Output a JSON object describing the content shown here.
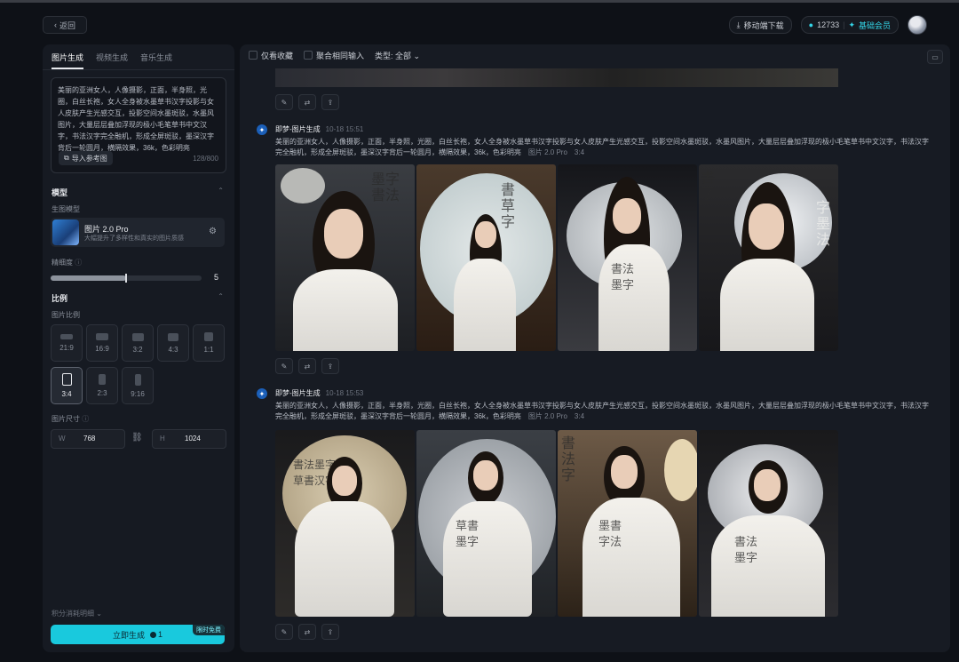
{
  "header": {
    "back_label": "返回",
    "mobile_download": "移动端下载",
    "credits": "12733",
    "membership": "基础会员"
  },
  "left": {
    "tabs": [
      "图片生成",
      "视频生成",
      "音乐生成"
    ],
    "prompt": "美丽的亚洲女人，人像摄影，正面，半身照，光圈，白丝长袍，女人全身被水墨草书汉字投影与女人皮肤产生光感交互，投影空间水墨斑驳，水墨风图片，大量层层叠加浮现的极小毛笔草书中文汉字，书法汉字完全融机，形成全屏斑驳，墨深汉字背后一轮圆月，横隔效果，36k，色彩明亮",
    "ref_button": "导入参考图",
    "counter": "128/800",
    "model_section": "模型",
    "model_label": "生图模型",
    "model_name": "图片 2.0 Pro",
    "model_desc": "大幅提升了多样性和真实的图片质感",
    "precision_label": "精细度",
    "precision_value": "5",
    "precision_fraction": 0.5,
    "ratio_section": "比例",
    "ratio_label": "图片比例",
    "ratios": [
      "21:9",
      "16:9",
      "3:2",
      "4:3",
      "1:1",
      "3:4",
      "2:3",
      "9:16"
    ],
    "selected_ratio": "3:4",
    "size_label": "图片尺寸",
    "width_label": "W",
    "width_value": "768",
    "height_label": "H",
    "height_value": "1024",
    "detail_label": "积分消耗明细",
    "generate_label": "立即生成",
    "generate_cost": "1",
    "limited_badge": "限时免费"
  },
  "right": {
    "filter_favorites": "仅看收藏",
    "filter_merge": "聚合相同输入",
    "filter_type": "类型: 全部",
    "jobs": [
      {
        "title": "即梦-图片生成",
        "time": "10-18  15:51",
        "prompt": "美丽的亚洲女人，人像摄影，正面，半身照，光圈，白丝长袍，女人全身被水墨草书汉字投影与女人皮肤产生光感交互，投影空间水墨斑驳，水墨风图片，大量层层叠加浮现的极小毛笔草书中文汉字，书法汉字完全融机，形成全屏斑驳，墨深汉字背后一轮圆月，横隔效果，36k，色彩明亮",
        "model": "图片 2.0 Pro",
        "ratio": "3:4"
      },
      {
        "title": "即梦-图片生成",
        "time": "10-18  15:53",
        "prompt": "美丽的亚洲女人，人像摄影，正面，半身照，光圈，白丝长袍，女人全身被水墨草书汉字投影与女人皮肤产生光感交互，投影空间水墨斑驳，水墨风图片，大量层层叠加浮现的极小毛笔草书中文汉字，书法汉字完全融机，形成全屏斑驳，墨深汉字背后一轮圆月，横隔效果，36k，色彩明亮",
        "model": "图片 2.0 Pro",
        "ratio": "3:4"
      }
    ]
  },
  "colors": {
    "accent": "#19c9dd",
    "bg": "#0e1117",
    "panel": "#161a22"
  }
}
